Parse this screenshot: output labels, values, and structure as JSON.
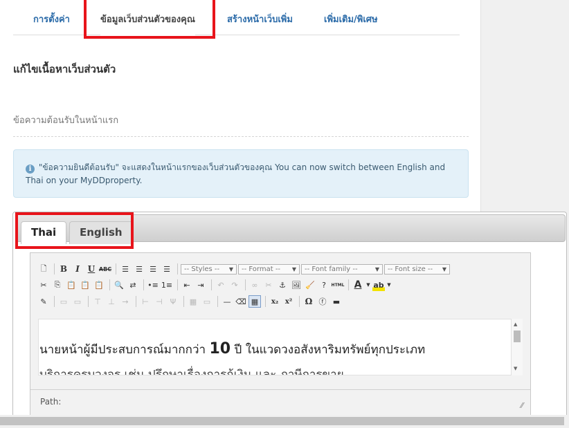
{
  "nav": {
    "tabs": [
      {
        "label": "การตั้งค่า"
      },
      {
        "label": "ข้อมูลเว็บส่วนตัวของคุณ"
      },
      {
        "label": "สร้างหน้าเว็บเพิ่ม"
      },
      {
        "label": "เพิ่มเติม/พิเศษ"
      }
    ],
    "active_index": 1
  },
  "page": {
    "heading": "แก้ไขเนื้อหาเว็บส่วนตัว",
    "subheading": "ข้อความต้อนรับในหน้าแรก",
    "info_text": "\"ข้อความยินดีต้อนรับ\" จะแสดงในหน้าแรกของเว็บส่วนตัวของคุณ You can now switch between English and Thai on your MyDDproperty."
  },
  "language_tabs": [
    {
      "label": "Thai",
      "active": true
    },
    {
      "label": "English",
      "active": false
    }
  ],
  "editor": {
    "dropdowns": {
      "styles": "-- Styles --",
      "format": "-- Format --",
      "font_family": "-- Font family --",
      "font_size": "-- Font size --"
    },
    "content_line1_a": "นายหน้าผู้มีประสบการณ์มากกว่า",
    "content_line1_num": "10",
    "content_line1_b": "ปี ในแวดวงอสังหาริมทรัพย์ทุกประเภท",
    "content_line2": "บริการครบวงจร เช่น ปรึกษาเรื่องการกู้เงิน และ ภาษีการขาย",
    "path_label": "Path:"
  },
  "colors": {
    "highlight": "#e8141b",
    "link": "#2a6aa8",
    "info_bg": "#e4f1f9"
  }
}
